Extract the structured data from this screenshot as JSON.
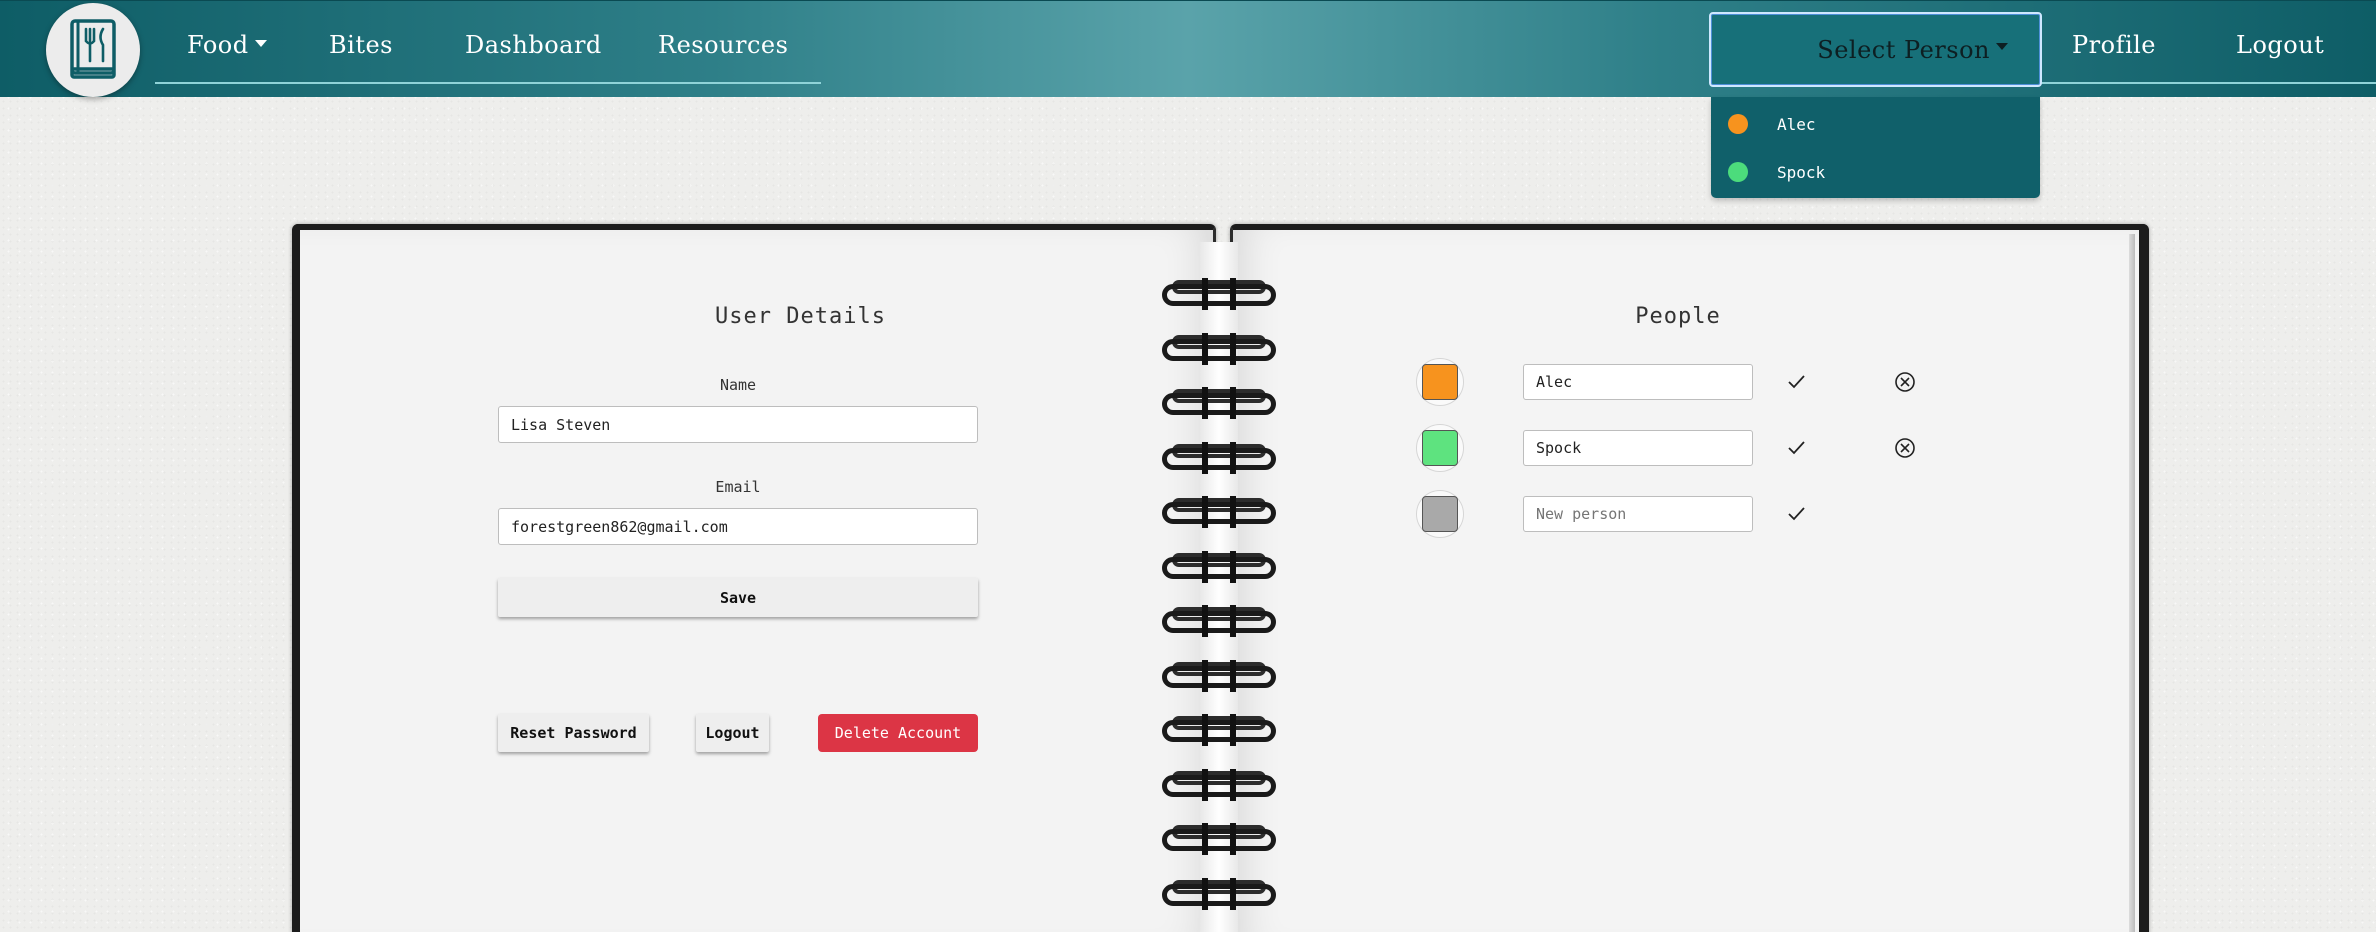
{
  "nav": {
    "food": "Food",
    "bites": "Bites",
    "dashboard": "Dashboard",
    "resources": "Resources",
    "select_person": "Select Person",
    "profile": "Profile",
    "logout": "Logout"
  },
  "dropdown": {
    "items": [
      {
        "label": "Alec",
        "color": "#f7931e"
      },
      {
        "label": "Spock",
        "color": "#4cdc7c"
      }
    ]
  },
  "user_details": {
    "title": "User Details",
    "name_label": "Name",
    "name_value": "Lisa Steven",
    "email_label": "Email",
    "email_value": "forestgreen862@gmail.com",
    "save": "Save",
    "reset_password": "Reset Password",
    "logout": "Logout",
    "delete_account": "Delete Account"
  },
  "people": {
    "title": "People",
    "rows": [
      {
        "name": "Alec",
        "color": "#f7931e",
        "removable": true
      },
      {
        "name": "Spock",
        "color": "#5ee37f",
        "removable": true
      },
      {
        "name": "",
        "placeholder": "New person",
        "color": "#a9a9a9",
        "removable": false
      }
    ]
  },
  "colors": {
    "navbar": "#0e5d66",
    "dropdown": "#10606a",
    "danger": "#dc3545"
  }
}
